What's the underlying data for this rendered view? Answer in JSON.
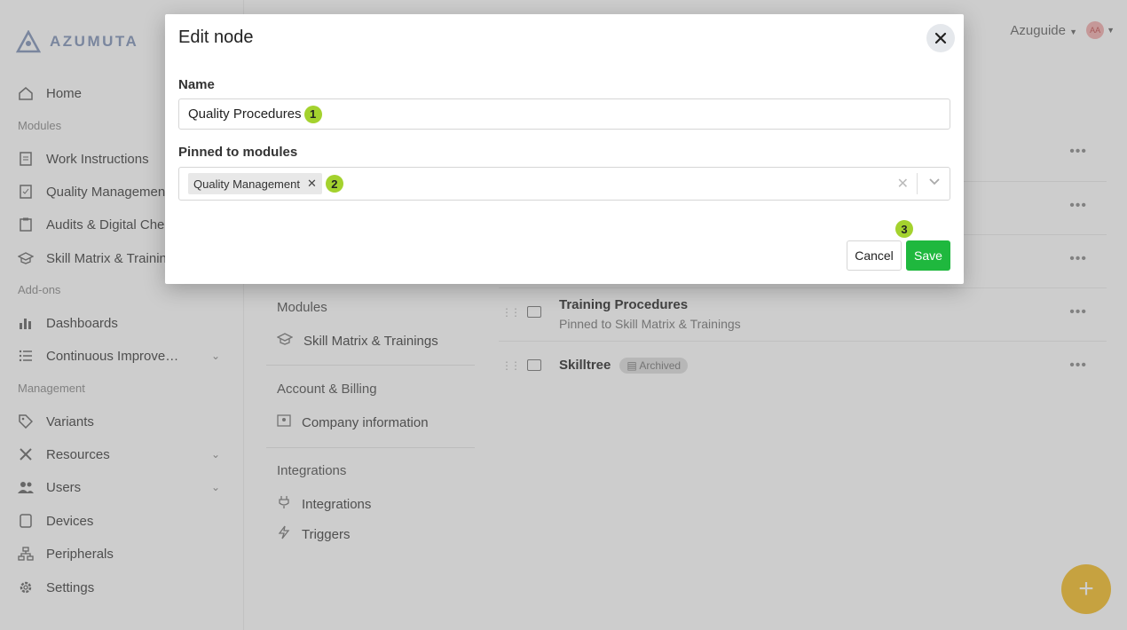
{
  "brand": {
    "name": "AZUMUTA"
  },
  "topbar": {
    "workspace": "Azuguide",
    "avatar_initials": "AA"
  },
  "sidebar": {
    "home": "Home",
    "sections": [
      "Modules",
      "Add-ons",
      "Management"
    ],
    "modules": [
      "Work Instructions",
      "Quality Management",
      "Audits & Digital Checklists",
      "Skill Matrix & Trainings"
    ],
    "addons": [
      "Dashboards",
      "Continuous Improvement"
    ],
    "management": [
      "Variants",
      "Resources",
      "Users",
      "Devices",
      "Peripherals",
      "Settings"
    ]
  },
  "middle": {
    "modules_heading": "Modules",
    "modules_item": "Skill Matrix & Trainings",
    "account_heading": "Account & Billing",
    "account_item": "Company information",
    "integrations_heading": "Integrations",
    "integrations_items": [
      "Integrations",
      "Triggers"
    ]
  },
  "nodes": [
    {
      "title": "Training Procedures",
      "subtitle": "Pinned to Skill Matrix & Trainings"
    },
    {
      "title": "Skilltree",
      "badge": "Archived"
    }
  ],
  "modal": {
    "title": "Edit node",
    "name_label": "Name",
    "name_value": "Quality Procedures",
    "pinned_label": "Pinned to modules",
    "pinned_chips": [
      "Quality Management"
    ],
    "cancel_label": "Cancel",
    "save_label": "Save",
    "steps": [
      "1",
      "2",
      "3"
    ]
  },
  "colors": {
    "save": "#1fb83e",
    "step_badge": "#a4d22e",
    "fab": "#f6c542"
  }
}
